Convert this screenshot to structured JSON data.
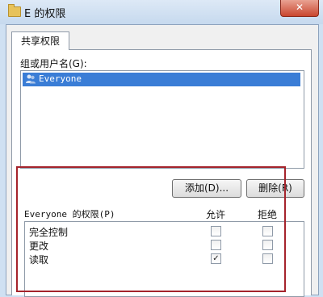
{
  "window": {
    "title": "E 的权限",
    "close_glyph": "✕"
  },
  "tabs": [
    {
      "label": "共享权限"
    }
  ],
  "users_group": {
    "label": "组或用户名(G):",
    "items": [
      {
        "name": "Everyone",
        "icon": "users-group-icon",
        "selected": true
      }
    ]
  },
  "buttons": {
    "add": "添加(D)...",
    "remove": "删除(R)"
  },
  "permissions": {
    "title": "Everyone 的权限(P)",
    "col_allow": "允许",
    "col_deny": "拒绝",
    "rows": [
      {
        "name": "完全控制",
        "allow": false,
        "deny": false
      },
      {
        "name": "更改",
        "allow": false,
        "deny": false
      },
      {
        "name": "读取",
        "allow": true,
        "deny": false
      }
    ]
  },
  "accent": {
    "selection": "#3a7dd6",
    "highlight_box": "#a5232b"
  }
}
